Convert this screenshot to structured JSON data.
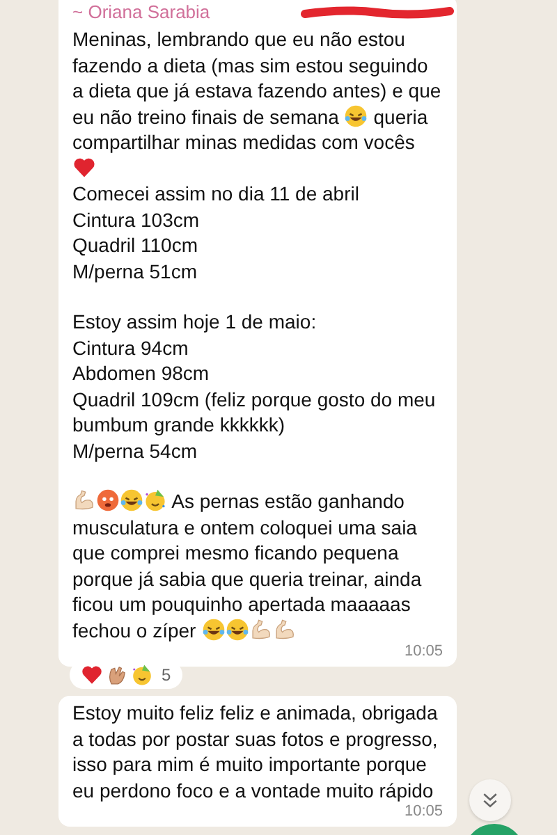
{
  "messages": [
    {
      "sender": "~ Oriana Sarabia",
      "redacted_phone": true,
      "time": "10:05",
      "blocks": [
        [
          [
            {
              "kind": "text",
              "text": "Meninas, lembrando que eu não estou fazendo a dieta (mas sim estou seguindo a dieta que já estava fazendo antes) e que eu não treino finais de semana "
            },
            {
              "kind": "laugh"
            },
            {
              "kind": "text",
              "text": " queria compartilhar minas medidas com vocês "
            },
            {
              "kind": "heart"
            }
          ],
          [
            {
              "kind": "text",
              "text": "Comecei assim no dia 11 de abril"
            }
          ],
          [
            {
              "kind": "text",
              "text": "Cintura 103cm"
            }
          ],
          [
            {
              "kind": "text",
              "text": "Quadril 110cm"
            }
          ],
          [
            {
              "kind": "text",
              "text": "M/perna 51cm"
            }
          ]
        ],
        [
          [
            {
              "kind": "text",
              "text": "Estoy assim hoje 1 de maio:"
            }
          ],
          [
            {
              "kind": "text",
              "text": "Cintura 94cm"
            }
          ],
          [
            {
              "kind": "text",
              "text": "Abdomen 98cm"
            }
          ],
          [
            {
              "kind": "text",
              "text": "Quadril 109cm (feliz porque gosto do meu bumbum grande kkkkkk)"
            }
          ],
          [
            {
              "kind": "text",
              "text": "M/perna 54cm"
            }
          ]
        ],
        [
          [
            {
              "kind": "muscle"
            },
            {
              "kind": "flushed"
            },
            {
              "kind": "laugh"
            },
            {
              "kind": "party"
            },
            {
              "kind": "text",
              "text": " As pernas estão ganhando musculatura e ontem coloquei uma saia que comprei mesmo ficando pequena porque já sabia que queria treinar, ainda ficou um pouquinho apertada maaaaas fechou o zíper "
            },
            {
              "kind": "laugh"
            },
            {
              "kind": "laugh"
            },
            {
              "kind": "muscle"
            },
            {
              "kind": "muscle"
            }
          ]
        ]
      ],
      "reactions": {
        "emojis": [
          {
            "kind": "heart"
          },
          {
            "kind": "clap"
          },
          {
            "kind": "party"
          }
        ],
        "count": "5"
      }
    },
    {
      "time": "10:05",
      "blocks": [
        [
          [
            {
              "kind": "text",
              "text": "Estoy muito feliz feliz e animada, obrigada a todas por postar suas fotos e progresso, isso para mim é muito importante porque eu perdono foco e a vontade muito rápido"
            }
          ]
        ]
      ]
    }
  ]
}
